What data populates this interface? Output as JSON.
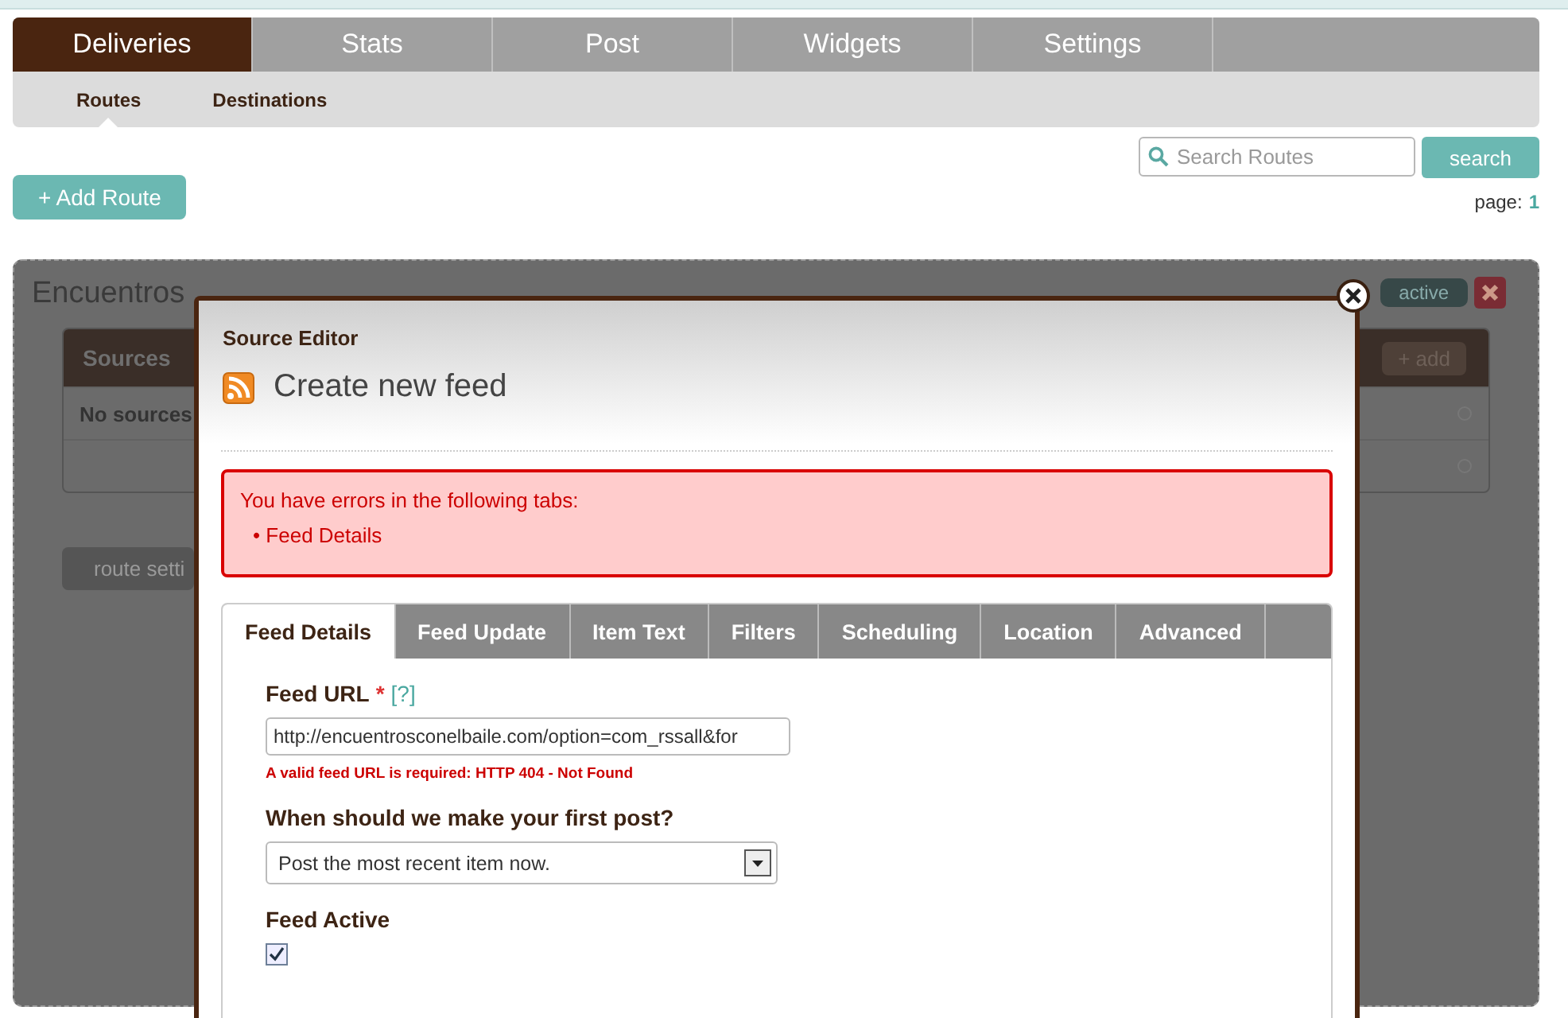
{
  "top_nav": {
    "tabs": [
      {
        "label": "Deliveries",
        "selected": true
      },
      {
        "label": "Stats",
        "selected": false
      },
      {
        "label": "Post",
        "selected": false
      },
      {
        "label": "Widgets",
        "selected": false
      },
      {
        "label": "Settings",
        "selected": false
      }
    ],
    "sub_tabs": [
      {
        "label": "Routes",
        "selected": true
      },
      {
        "label": "Destinations",
        "selected": false
      }
    ]
  },
  "search": {
    "placeholder": "Search Routes",
    "button": "search"
  },
  "add_route_button": "+ Add Route",
  "pagination": {
    "label": "page:",
    "current": "1"
  },
  "route": {
    "title": "Encuentros",
    "status": "active",
    "sources": {
      "title": "Sources",
      "add_button": "+ add",
      "empty_text": "No sources"
    },
    "settings_button": "route setti"
  },
  "dialog": {
    "heading": "Source Editor",
    "title": "Create new feed",
    "errors": {
      "message": "You have errors in the following tabs:",
      "items": [
        "• Feed Details"
      ]
    },
    "tabs": [
      {
        "label": "Feed Details",
        "selected": true
      },
      {
        "label": "Feed Update",
        "selected": false
      },
      {
        "label": "Item Text",
        "selected": false
      },
      {
        "label": "Filters",
        "selected": false
      },
      {
        "label": "Scheduling",
        "selected": false
      },
      {
        "label": "Location",
        "selected": false
      },
      {
        "label": "Advanced",
        "selected": false
      }
    ],
    "fields": [
      {
        "kind": "text",
        "label": "Feed URL",
        "required_mark": "*",
        "help": "[?]",
        "value": "http://encuentrosconelbaile.com/option=com_rssall&for",
        "error": "A valid feed URL is required: HTTP 404 - Not Found"
      },
      {
        "kind": "select",
        "label": "When should we make your first post?",
        "value": "Post the most recent item now."
      },
      {
        "kind": "checkbox",
        "label": "Feed Active",
        "checked": true
      }
    ]
  }
}
